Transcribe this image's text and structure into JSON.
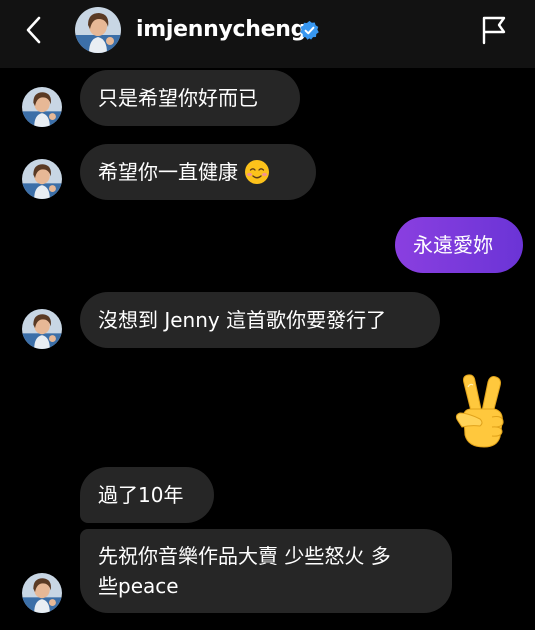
{
  "header": {
    "username": "imjennycheng",
    "back_icon": "chevron-left-icon",
    "verified_icon": "verified-badge-icon",
    "flag_icon": "flag-icon"
  },
  "colors": {
    "background": "#000000",
    "header_bg": "#121212",
    "received_bubble": "#262626",
    "sent_bubble": "#7c3aed",
    "verified_blue": "#3897f0"
  },
  "messages": [
    {
      "direction": "received",
      "text": "只是希望你好而已",
      "show_avatar": true
    },
    {
      "direction": "received",
      "text": "希望你一直健康",
      "emoji": "smiling-face-icon",
      "show_avatar": true
    },
    {
      "direction": "sent",
      "text": "永遠愛妳"
    },
    {
      "direction": "received",
      "text": "沒想到 Jenny 這首歌你要發行了",
      "show_avatar": true
    },
    {
      "direction": "sent",
      "emoji": "victory-hand-icon",
      "text": ""
    },
    {
      "direction": "received",
      "text": "過了10年",
      "show_avatar": false
    },
    {
      "direction": "received",
      "text": "先祝你音樂作品大賣 少些怒火 多些peace",
      "line1": "先祝你音樂作品大賣 少些怒火 多",
      "line2": "些peace",
      "show_avatar": true
    }
  ]
}
